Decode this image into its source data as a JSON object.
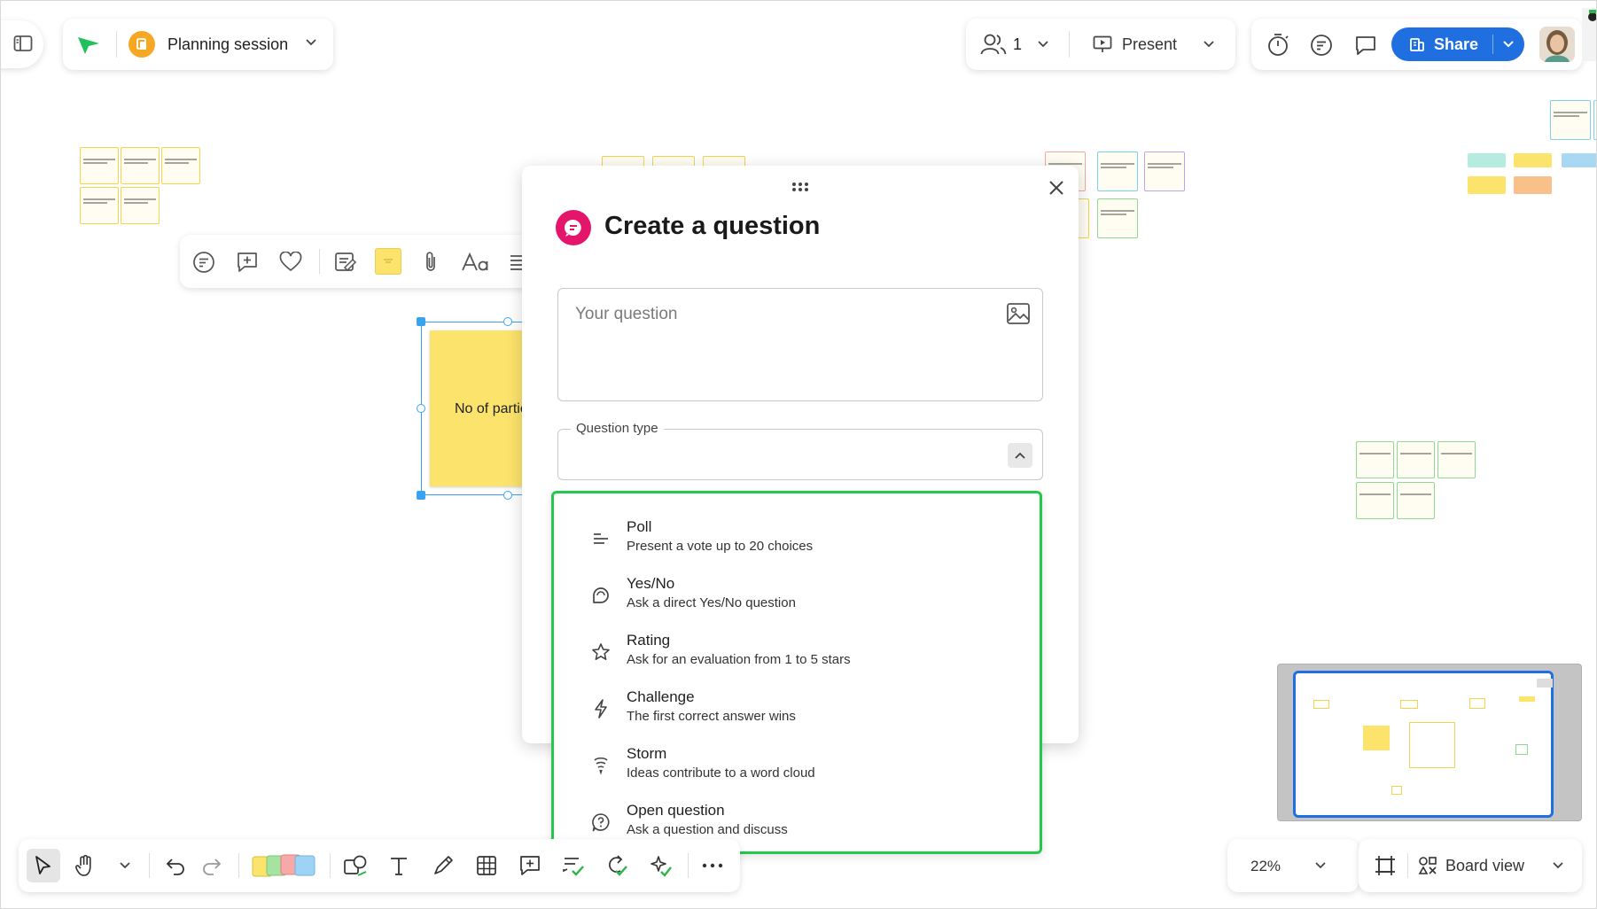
{
  "board": {
    "title": "Planning session",
    "participants_count": "1",
    "present_label": "Present",
    "share_label": "Share",
    "zoom": "22%",
    "board_view_label": "Board view",
    "selected_sticky_text": "No of partic"
  },
  "dialog": {
    "title": "Create a question",
    "question_placeholder": "Your question",
    "question_type_label": "Question type",
    "options": [
      {
        "icon": "poll-icon",
        "title": "Poll",
        "desc": "Present a vote up to 20 choices"
      },
      {
        "icon": "yes-no-icon",
        "title": "Yes/No",
        "desc": "Ask a direct Yes/No question"
      },
      {
        "icon": "star-icon",
        "title": "Rating",
        "desc": "Ask for an evaluation from 1 to 5 stars"
      },
      {
        "icon": "lightning-icon",
        "title": "Challenge",
        "desc": "The first correct answer wins"
      },
      {
        "icon": "storm-icon",
        "title": "Storm",
        "desc": "Ideas contribute to a word cloud"
      },
      {
        "icon": "open-question-icon",
        "title": "Open question",
        "desc": "Ask a question and discuss"
      }
    ],
    "highlight_color": "#22c94a"
  },
  "colors": {
    "accent_blue": "#1f6fe0",
    "brand_pink": "#e5156b",
    "sticky_yellow": "#fbe36c",
    "selection_blue": "#3aa3f0"
  }
}
